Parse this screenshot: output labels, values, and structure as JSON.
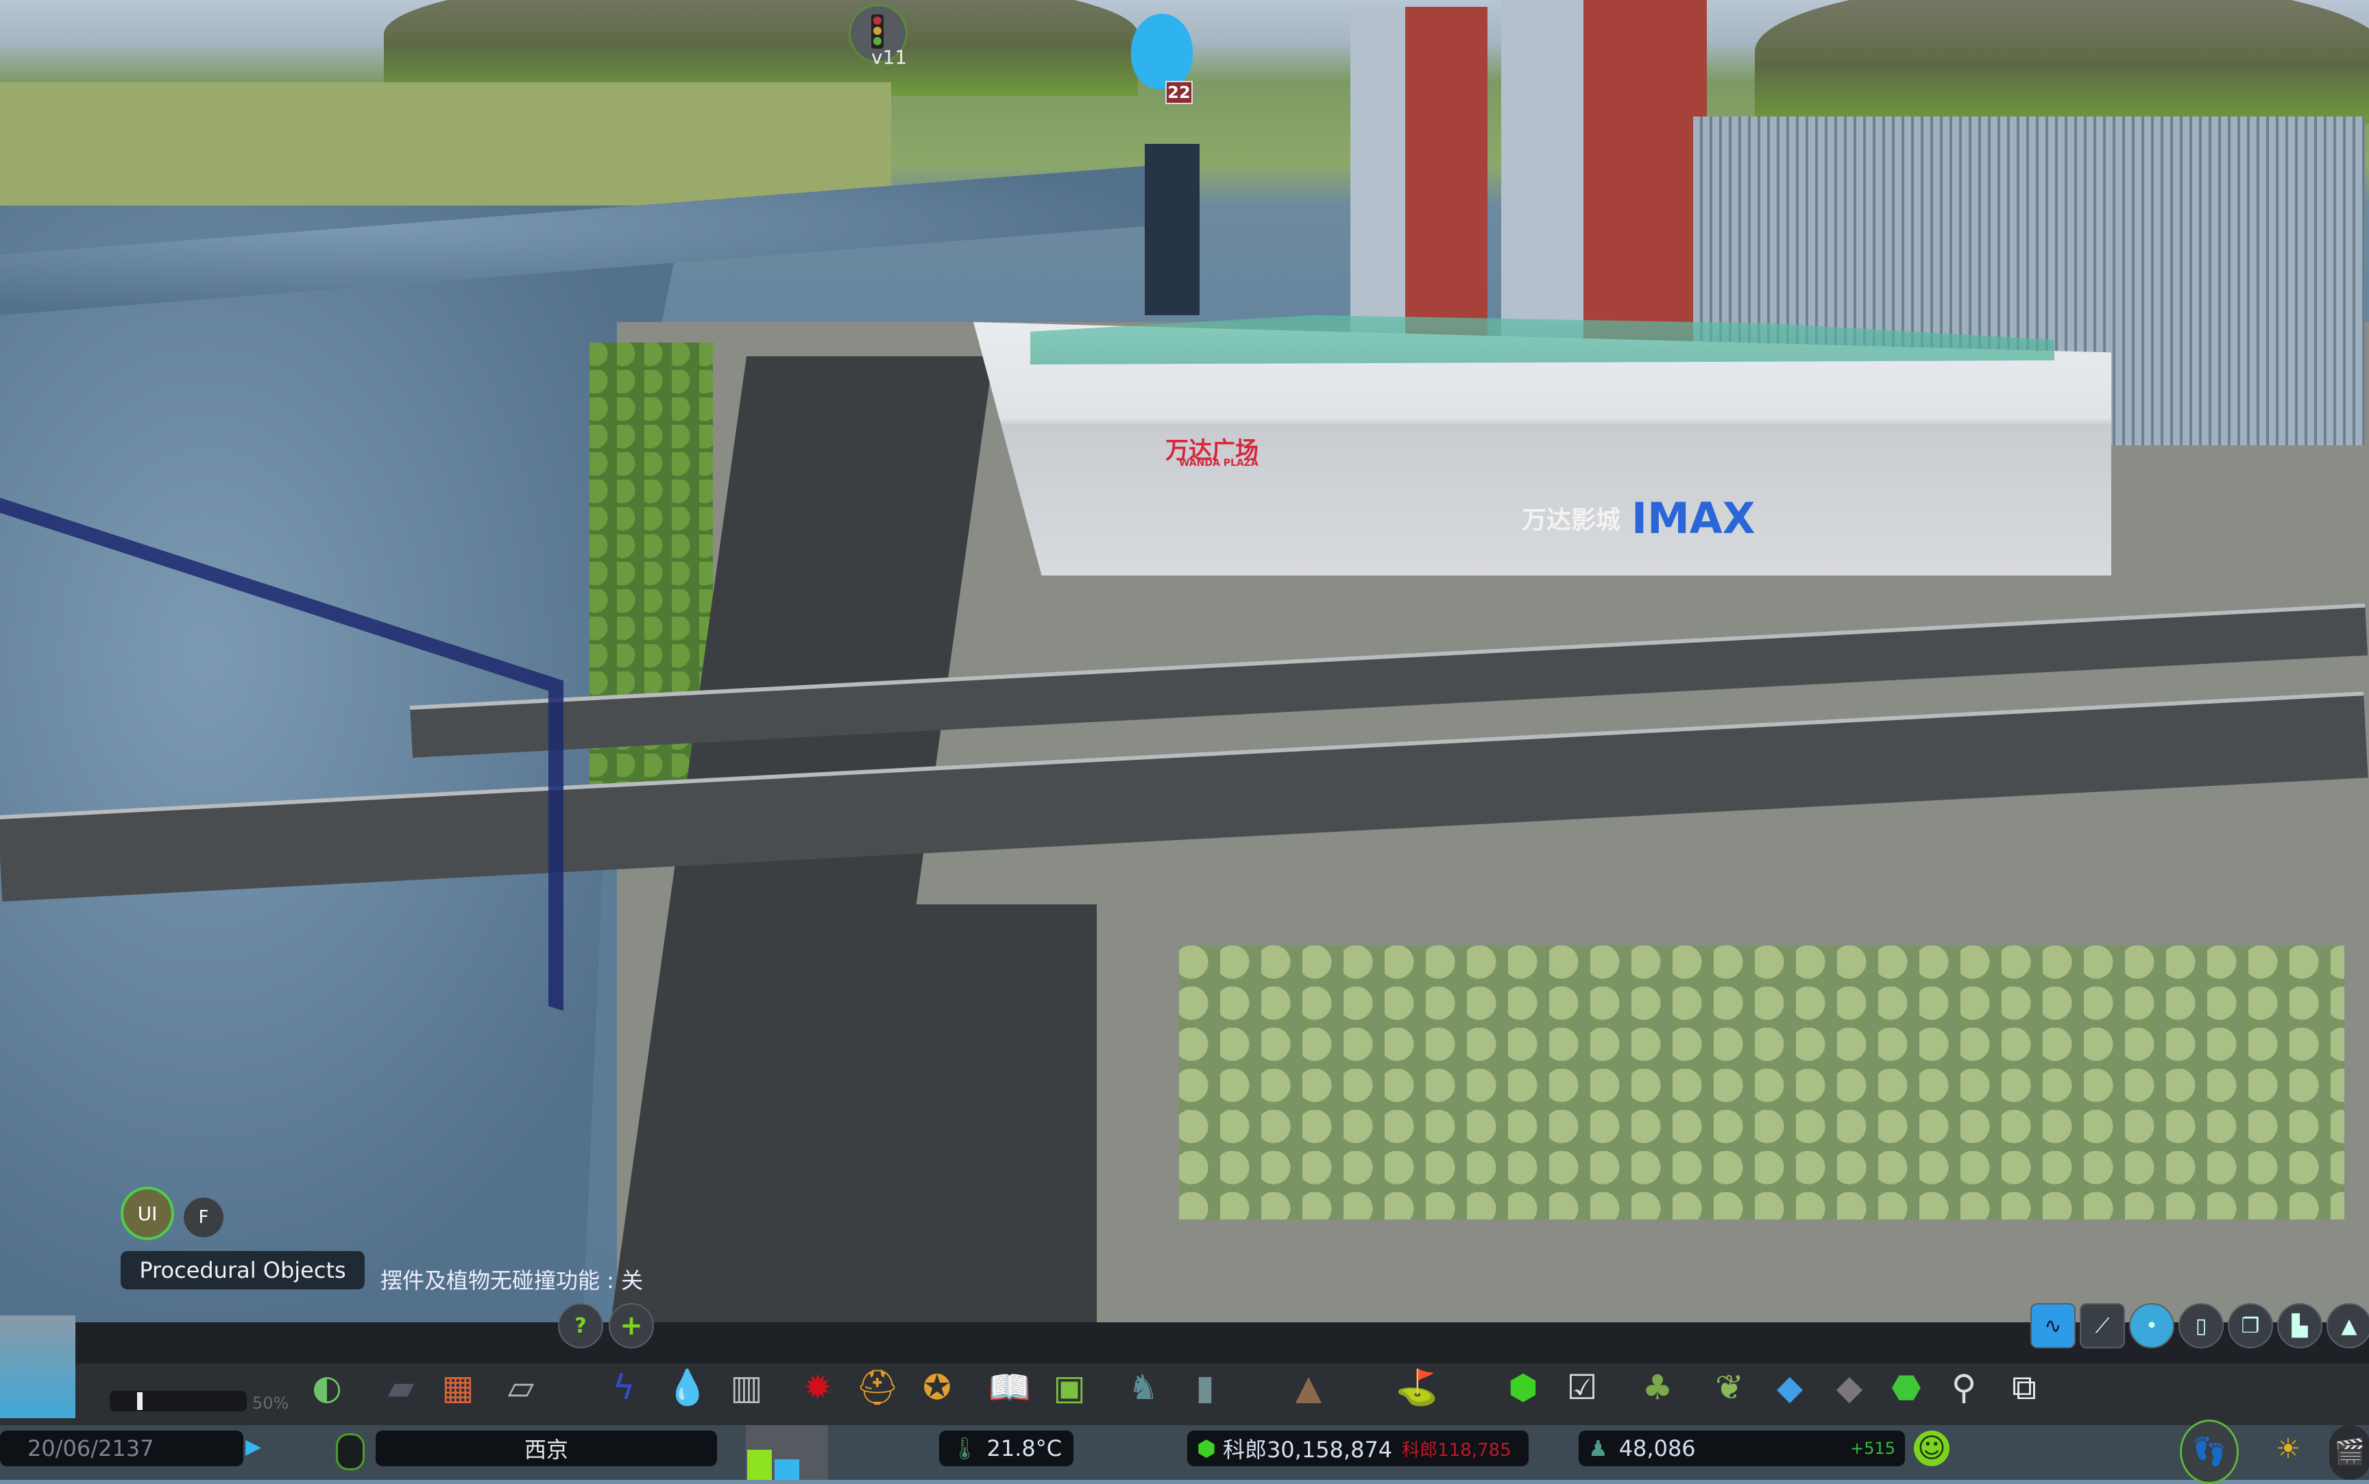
{
  "scene": {
    "mall_sign_cn": "万达广场",
    "mall_sign_en": "WANDA PLAZA",
    "cinema_sign_cn": "万达影城",
    "cinema_sign_en": "IMAX"
  },
  "markers": {
    "traffic_mod_version": "v11",
    "chirper_count": "22"
  },
  "overlay": {
    "ui_button": "UI",
    "f_button": "F",
    "procedural_objects_label": "Procedural Objects",
    "collision_status": "摆件及植物无碰撞功能 : 关"
  },
  "toolbar": {
    "help_label": "?",
    "add_label": "+",
    "volume_percent": "50%",
    "volume_level": 0.5,
    "icons": [
      "zoning-globe",
      "roads",
      "zoning",
      "districts",
      "electricity",
      "water",
      "garbage",
      "healthcare",
      "fire",
      "police",
      "education",
      "public-transport",
      "decoration",
      "monuments",
      "wonders",
      "landscaping",
      "money",
      "policies",
      "trees",
      "parks",
      "water-areas",
      "terrain",
      "unique-buildings",
      "search",
      "traffic-cams"
    ],
    "info_views": [
      "info-view-wave",
      "info-view-graph",
      "info-view-circle",
      "info-view-page",
      "info-view-pages",
      "info-view-buildings",
      "info-view-triangle"
    ]
  },
  "status_bar": {
    "date": "20/06/2137",
    "city_name": "西京",
    "rci_demand": {
      "residential": 0.55,
      "commercial": 0.38,
      "industrial": 0.0
    },
    "temperature": "21.8°C",
    "money": "科郎30,158,874",
    "money_change": "科郎118,785",
    "population": "48,086",
    "population_change": "+515",
    "colors": {
      "money_change": "#c0182a",
      "population_change": "#2fbf3a",
      "accent_green": "#7ed321",
      "accent_blue": "#35b6f0"
    }
  }
}
